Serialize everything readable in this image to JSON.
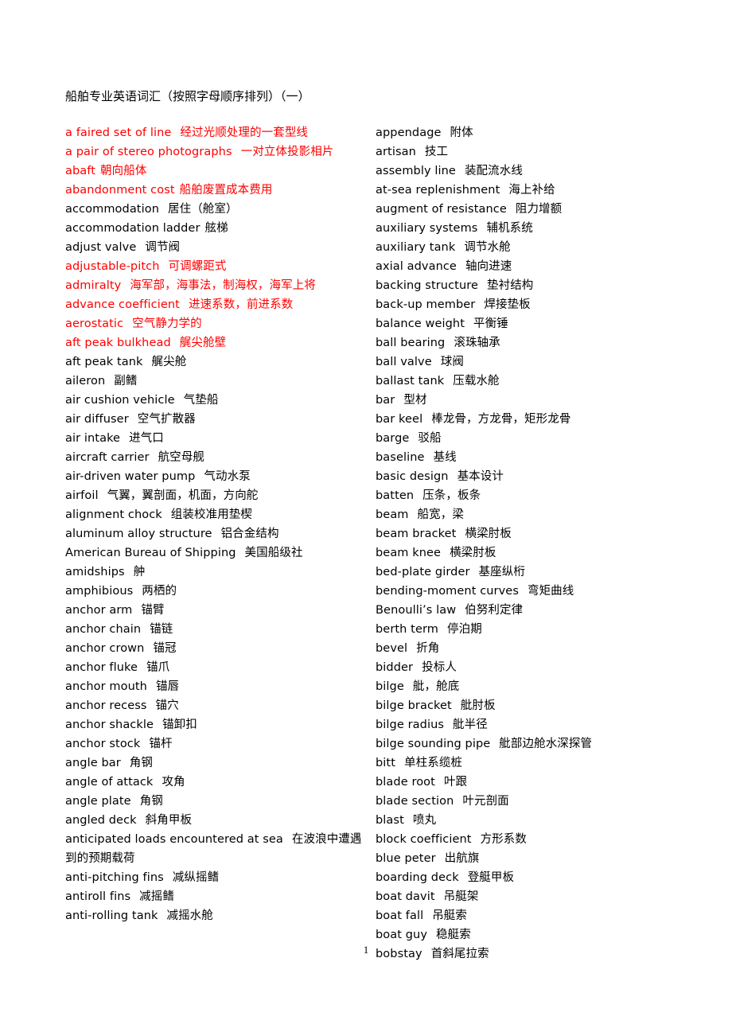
{
  "document": {
    "title": "船舶专业英语词汇（按照字母顺序排列）（一）",
    "page_number": "1",
    "accent_red": "#ff0000",
    "text_color": "#000000"
  },
  "columns": {
    "left": [
      {
        "term": "a faired set of line",
        "cn": "经过光顺处理的一套型线",
        "color": "red",
        "gap": "wide"
      },
      {
        "term": "a  pair of stereo photographs",
        "cn": "一对立体投影相片",
        "color": "red",
        "gap": "wide"
      },
      {
        "term": "abaft",
        "cn": "朝向船体",
        "color": "red",
        "gap": "narrow"
      },
      {
        "term": "abandonment cost",
        "cn": "船舶废置成本费用",
        "color": "red",
        "gap": "narrow"
      },
      {
        "term": "accommodation",
        "cn": "居住（舱室）",
        "color": "black",
        "gap": "wide"
      },
      {
        "term": "accommodation ladder",
        "cn": "舷梯",
        "color": "black",
        "gap": "narrow"
      },
      {
        "term": "adjust valve",
        "cn": "调节阀",
        "color": "black",
        "gap": "wide"
      },
      {
        "term": "adjustable-pitch",
        "cn": "可调螺距式",
        "color": "red",
        "gap": "wide"
      },
      {
        "term": "admiralty",
        "cn": "海军部，海事法，制海权，海军上将",
        "color": "red",
        "gap": "wide"
      },
      {
        "term": "advance coefficient",
        "cn": "进速系数，前进系数",
        "color": "red",
        "gap": "wide"
      },
      {
        "term": "aerostatic",
        "cn": "空气静力学的",
        "color": "red",
        "gap": "wide"
      },
      {
        "term": "aft peak bulkhead",
        "cn": "艉尖舱壁",
        "color": "red",
        "gap": "wide"
      },
      {
        "term": "aft peak tank",
        "cn": "艉尖舱",
        "color": "black",
        "gap": "wide"
      },
      {
        "term": "aileron",
        "cn": "副鳍",
        "color": "black",
        "gap": "wide"
      },
      {
        "term": "air cushion vehicle",
        "cn": "气垫船",
        "color": "black",
        "gap": "wide"
      },
      {
        "term": "air diffuser",
        "cn": "空气扩散器",
        "color": "black",
        "gap": "wide"
      },
      {
        "term": "air intake",
        "cn": "进气口",
        "color": "black",
        "gap": "wide"
      },
      {
        "term": "aircraft carrier",
        "cn": "航空母舰",
        "color": "black",
        "gap": "wide"
      },
      {
        "term": "air-driven water pump",
        "cn": "气动水泵",
        "color": "black",
        "gap": "wide"
      },
      {
        "term": "airfoil",
        "cn": "气翼，翼剖面，机面，方向舵",
        "color": "black",
        "gap": "wide"
      },
      {
        "term": "alignment chock",
        "cn": "组装校准用垫楔",
        "color": "black",
        "gap": "wide"
      },
      {
        "term": "aluminum alloy structure",
        "cn": "铝合金结构",
        "color": "black",
        "gap": "wide"
      },
      {
        "term": "American Bureau of Shipping",
        "cn": "美国船级社",
        "color": "black",
        "gap": "wide"
      },
      {
        "term": "amidships",
        "cn": "舯",
        "color": "black",
        "gap": "wide"
      },
      {
        "term": "amphibious",
        "cn": "两栖的",
        "color": "black",
        "gap": "wide"
      },
      {
        "term": "anchor arm",
        "cn": "锚臂",
        "color": "black",
        "gap": "wide"
      },
      {
        "term": "anchor chain",
        "cn": "锚链",
        "color": "black",
        "gap": "wide"
      },
      {
        "term": "anchor crown",
        "cn": "锚冠",
        "color": "black",
        "gap": "wide"
      },
      {
        "term": "anchor fluke",
        "cn": "锚爪",
        "color": "black",
        "gap": "wide"
      },
      {
        "term": "anchor mouth",
        "cn": "锚唇",
        "color": "black",
        "gap": "wide"
      },
      {
        "term": "anchor recess",
        "cn": "锚穴",
        "color": "black",
        "gap": "wide"
      },
      {
        "term": "anchor shackle",
        "cn": "锚卸扣",
        "color": "black",
        "gap": "wide"
      },
      {
        "term": "anchor stock",
        "cn": "锚杆",
        "color": "black",
        "gap": "wide"
      },
      {
        "term": "angle bar",
        "cn": "角钢",
        "color": "black",
        "gap": "wide"
      },
      {
        "term": "angle of attack",
        "cn": "攻角",
        "color": "black",
        "gap": "wide"
      },
      {
        "term": "angle plate",
        "cn": "角钢",
        "color": "black",
        "gap": "wide"
      },
      {
        "term": "angled deck",
        "cn": "斜角甲板",
        "color": "black",
        "gap": "wide"
      },
      {
        "term": "anticipated loads encountered at sea",
        "cn": "在波浪中遭遇到的预期载荷",
        "color": "black",
        "gap": "wide"
      },
      {
        "term": "anti-pitching fins",
        "cn": "减纵摇鳍",
        "color": "black",
        "gap": "wide"
      },
      {
        "term": "antiroll fins",
        "cn": "减摇鳍",
        "color": "black",
        "gap": "wide"
      },
      {
        "term": "anti-rolling tank",
        "cn": "减摇水舱",
        "color": "black",
        "gap": "wide"
      }
    ],
    "right": [
      {
        "term": "appendage",
        "cn": "附体",
        "color": "black",
        "gap": "wide"
      },
      {
        "term": "artisan",
        "cn": "技工",
        "color": "black",
        "gap": "wide"
      },
      {
        "term": "assembly line",
        "cn": "装配流水线",
        "color": "black",
        "gap": "wide"
      },
      {
        "term": "at-sea replenishment",
        "cn": "海上补给",
        "color": "black",
        "gap": "wide"
      },
      {
        "term": "augment of resistance",
        "cn": "阻力增额",
        "color": "black",
        "gap": "wide"
      },
      {
        "term": "auxiliary systems",
        "cn": "辅机系统",
        "color": "black",
        "gap": "wide"
      },
      {
        "term": "auxiliary tank",
        "cn": "调节水舱",
        "color": "black",
        "gap": "wide"
      },
      {
        "term": "axial advance",
        "cn": "轴向进速",
        "color": "black",
        "gap": "wide"
      },
      {
        "term": "backing structure",
        "cn": "垫衬结构",
        "color": "black",
        "gap": "wide"
      },
      {
        "term": "back-up member",
        "cn": "焊接垫板",
        "color": "black",
        "gap": "wide"
      },
      {
        "term": "balance weight",
        "cn": "平衡锤",
        "color": "black",
        "gap": "wide"
      },
      {
        "term": "ball bearing",
        "cn": "滚珠轴承",
        "color": "black",
        "gap": "wide"
      },
      {
        "term": "ball valve",
        "cn": "球阀",
        "color": "black",
        "gap": "wide"
      },
      {
        "term": "ballast tank",
        "cn": "压载水舱",
        "color": "black",
        "gap": "wide"
      },
      {
        "term": "bar",
        "cn": "型材",
        "color": "black",
        "gap": "wide"
      },
      {
        "term": "bar keel",
        "cn": "棒龙骨，方龙骨，矩形龙骨",
        "color": "black",
        "gap": "wide"
      },
      {
        "term": "barge",
        "cn": "驳船",
        "color": "black",
        "gap": "wide"
      },
      {
        "term": "baseline",
        "cn": "基线",
        "color": "black",
        "gap": "wide"
      },
      {
        "term": "basic design",
        "cn": "基本设计",
        "color": "black",
        "gap": "wide"
      },
      {
        "term": "batten",
        "cn": "压条，板条",
        "color": "black",
        "gap": "wide"
      },
      {
        "term": "beam",
        "cn": "船宽，梁",
        "color": "black",
        "gap": "wide"
      },
      {
        "term": "beam bracket",
        "cn": "横梁肘板",
        "color": "black",
        "gap": "wide"
      },
      {
        "term": "beam knee",
        "cn": "横梁肘板",
        "color": "black",
        "gap": "wide"
      },
      {
        "term": "bed-plate girder",
        "cn": "基座纵桁",
        "color": "black",
        "gap": "wide"
      },
      {
        "term": "bending-moment curves",
        "cn": "弯矩曲线",
        "color": "black",
        "gap": "wide"
      },
      {
        "term": "Benoulli’s law",
        "cn": "伯努利定律",
        "color": "black",
        "gap": "wide"
      },
      {
        "term": "berth term",
        "cn": "停泊期",
        "color": "black",
        "gap": "wide"
      },
      {
        "term": "bevel",
        "cn": "折角",
        "color": "black",
        "gap": "wide"
      },
      {
        "term": "bidder",
        "cn": "投标人",
        "color": "black",
        "gap": "wide"
      },
      {
        "term": "bilge",
        "cn": "舭，舱底",
        "color": "black",
        "gap": "wide"
      },
      {
        "term": "bilge bracket",
        "cn": "舭肘板",
        "color": "black",
        "gap": "wide"
      },
      {
        "term": "bilge radius",
        "cn": "舭半径",
        "color": "black",
        "gap": "wide"
      },
      {
        "term": "bilge sounding pipe",
        "cn": "舭部边舱水深探管",
        "color": "black",
        "gap": "wide"
      },
      {
        "term": "bitt",
        "cn": "单柱系缆桩",
        "color": "black",
        "gap": "wide"
      },
      {
        "term": "blade root",
        "cn": "叶跟",
        "color": "black",
        "gap": "wide"
      },
      {
        "term": "blade section",
        "cn": "叶元剖面",
        "color": "black",
        "gap": "wide"
      },
      {
        "term": "blast",
        "cn": "喷丸",
        "color": "black",
        "gap": "wide"
      },
      {
        "term": "block coefficient",
        "cn": "方形系数",
        "color": "black",
        "gap": "wide"
      },
      {
        "term": "blue peter",
        "cn": "出航旗",
        "color": "black",
        "gap": "wide"
      },
      {
        "term": "boarding deck",
        "cn": "登艇甲板",
        "color": "black",
        "gap": "wide"
      },
      {
        "term": "boat davit",
        "cn": "吊艇架",
        "color": "black",
        "gap": "wide"
      },
      {
        "term": "boat fall",
        "cn": "吊艇索",
        "color": "black",
        "gap": "wide"
      },
      {
        "term": "boat guy",
        "cn": "稳艇索",
        "color": "black",
        "gap": "wide"
      },
      {
        "term": "bobstay",
        "cn": "首斜尾拉索",
        "color": "black",
        "gap": "wide"
      }
    ]
  }
}
